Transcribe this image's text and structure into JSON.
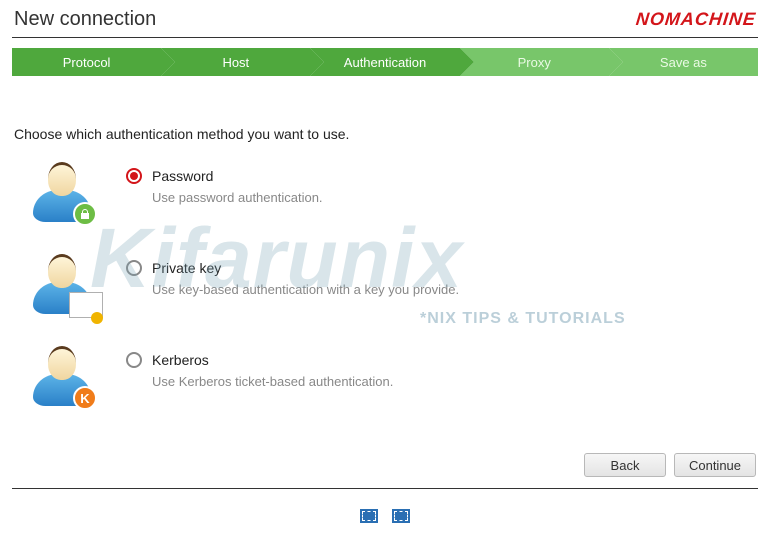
{
  "header": {
    "title": "New connection",
    "brand": "NOMACHINE"
  },
  "wizard": {
    "steps": [
      {
        "label": "Protocol",
        "state": "done"
      },
      {
        "label": "Host",
        "state": "done"
      },
      {
        "label": "Authentication",
        "state": "active"
      },
      {
        "label": "Proxy",
        "state": "future"
      },
      {
        "label": "Save as",
        "state": "future"
      }
    ]
  },
  "prompt": "Choose which authentication method you want to use.",
  "options": [
    {
      "id": "password",
      "label": "Password",
      "description": "Use password authentication.",
      "selected": true,
      "badge": "lock"
    },
    {
      "id": "private-key",
      "label": "Private key",
      "description": "Use key-based authentication with a key you provide.",
      "selected": false,
      "badge": "cert"
    },
    {
      "id": "kerberos",
      "label": "Kerberos",
      "description": "Use Kerberos ticket-based authentication.",
      "selected": false,
      "badge": "K"
    }
  ],
  "buttons": {
    "back": "Back",
    "continue": "Continue"
  },
  "watermark": {
    "main": "Kifarunix",
    "sub": "*NIX TIPS & TUTORIALS"
  }
}
